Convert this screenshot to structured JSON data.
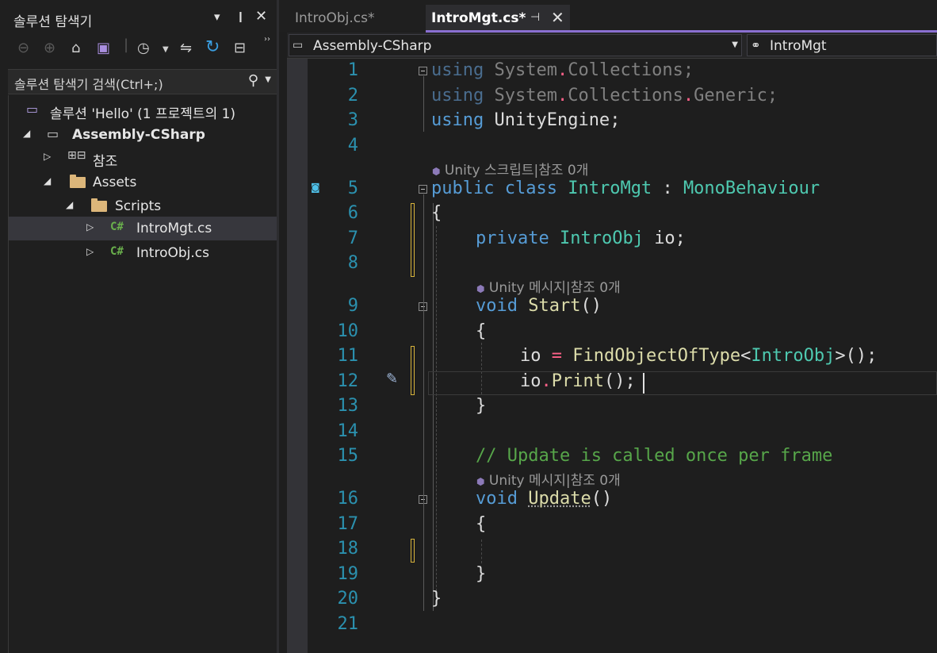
{
  "solution_explorer": {
    "title": "솔루션 탐색기",
    "title_buttons": {
      "menu": "▾",
      "pin": "📌",
      "close": "✕"
    },
    "search_placeholder": "솔루션 탐색기 검색(Ctrl+;)",
    "tree": [
      {
        "label": "솔루션 'Hello' (1 프로젝트의 1)",
        "icon": "solution-icon"
      },
      {
        "label": "Assembly-CSharp",
        "icon": "csharp-project-icon",
        "expanded": true
      },
      {
        "label": "참조",
        "icon": "references-icon",
        "expanded": false
      },
      {
        "label": "Assets",
        "icon": "folder-icon",
        "expanded": true
      },
      {
        "label": "Scripts",
        "icon": "folder-icon",
        "expanded": true
      },
      {
        "label": "IntroMgt.cs",
        "icon": "csharp-file-icon",
        "selected": true
      },
      {
        "label": "IntroObj.cs",
        "icon": "csharp-file-icon"
      }
    ]
  },
  "tabs": [
    {
      "label": "IntroObj.cs*",
      "active": false
    },
    {
      "label": "IntroMgt.cs*",
      "active": true
    }
  ],
  "nav": {
    "project": "Assembly-CSharp",
    "class": "IntroMgt"
  },
  "code_lens": {
    "class": "Unity 스크립트|참조 0개",
    "start": "Unity 메시지|참조 0개",
    "update": "Unity 메시지|참조 0개"
  },
  "line_numbers": [
    "1",
    "2",
    "3",
    "4",
    "5",
    "6",
    "7",
    "8",
    "9",
    "10",
    "11",
    "12",
    "13",
    "14",
    "15",
    "16",
    "17",
    "18",
    "19",
    "20",
    "21"
  ],
  "code": {
    "l1": {
      "kw": "using",
      "ns1": "System",
      "dot": ".",
      "ns2": "Collections",
      "end": ";"
    },
    "l2": {
      "kw": "using",
      "ns1": "System",
      "dot1": ".",
      "ns2": "Collections",
      "dot2": ".",
      "ns3": "Generic",
      "end": ";"
    },
    "l3": {
      "kw": "using",
      "ns": "UnityEngine",
      "end": ";"
    },
    "l5": {
      "kw1": "public",
      "kw2": "class",
      "name": "IntroMgt",
      "colon": ":",
      "base": "MonoBehaviour"
    },
    "l6": "{",
    "l7": {
      "kw": "private",
      "type": "IntroObj",
      "rest": "io;"
    },
    "l9": {
      "kw": "void",
      "name": "Start",
      "parens": "()"
    },
    "l10": "{",
    "l11": {
      "a": "io",
      "eq": "=",
      "fn": "FindObjectOfType",
      "lt": "<",
      "type": "IntroObj",
      "rest": ">();"
    },
    "l12": {
      "a": "io",
      "dot": ".",
      "fn": "Print",
      "rest": "();"
    },
    "l13": "}",
    "l15": "// Update is called once per frame",
    "l16": {
      "kw": "void",
      "name": "Update",
      "parens": "()"
    },
    "l17": "{",
    "l19": "}",
    "l20": "}"
  }
}
